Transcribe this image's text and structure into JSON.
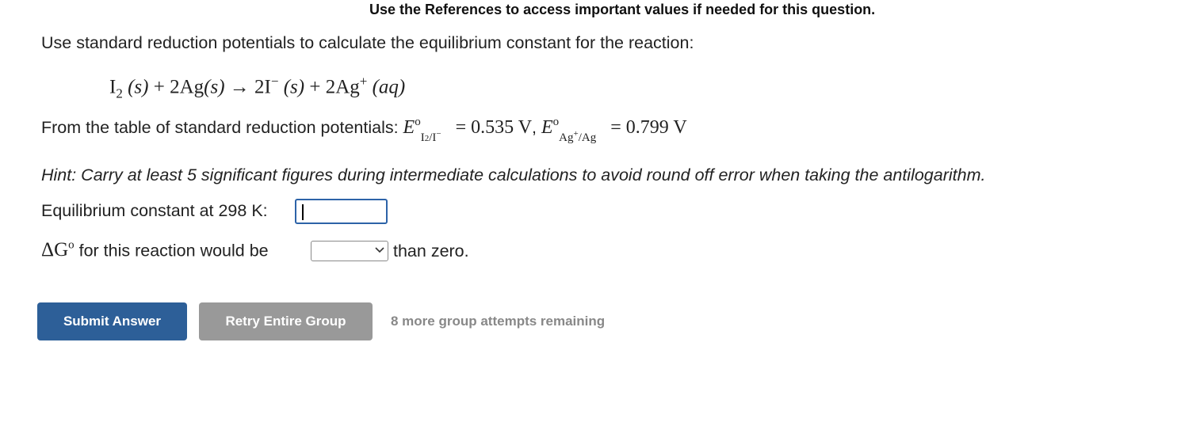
{
  "notice": "Use the References to access important values if needed for this question.",
  "question": "Use standard reduction potentials to calculate the equilibrium constant for the reaction:",
  "equation": {
    "reactant1": "I",
    "reactant1_sub": "2",
    "reactant1_state": "(s)",
    "plus1": "+",
    "reactant2": "2Ag",
    "reactant2_state": "(s)",
    "arrow": "→",
    "product1": "2I",
    "product1_sup": "−",
    "product1_state": "(s)",
    "plus2": "+",
    "product2": "2Ag",
    "product2_sup": "+",
    "product2_state": "(aq)"
  },
  "given": {
    "prefix": "From the table of standard reduction potentials: ",
    "e1_symbol": "E",
    "e1_sup": "o",
    "e1_sub_a": "I",
    "e1_sub_a2": "2",
    "e1_sub_b": "/I",
    "e1_sub_b_sup": "−",
    "e1_value": "= 0.535 V",
    "separator": ", ",
    "e2_symbol": "E",
    "e2_sup": "o",
    "e2_sub_a": "Ag",
    "e2_sub_a_sup": "+",
    "e2_sub_b": "/Ag",
    "e2_value": "= 0.799 V"
  },
  "hint": "Hint: Carry at least 5 significant figures during intermediate calculations to avoid round off error when taking the antilogarithm.",
  "keq": {
    "label": "Equilibrium constant at 298 K:",
    "value": ""
  },
  "dg": {
    "symbol": "ΔG",
    "sup": "o",
    "label": " for this reaction would be",
    "selected": "",
    "suffix": "than zero."
  },
  "buttons": {
    "submit": "Submit Answer",
    "retry": "Retry Entire Group"
  },
  "attempts": "8 more group attempts remaining",
  "colors": {
    "primary": "#2d5f98",
    "secondary": "#999999",
    "input_focus": "#2d63a8"
  }
}
